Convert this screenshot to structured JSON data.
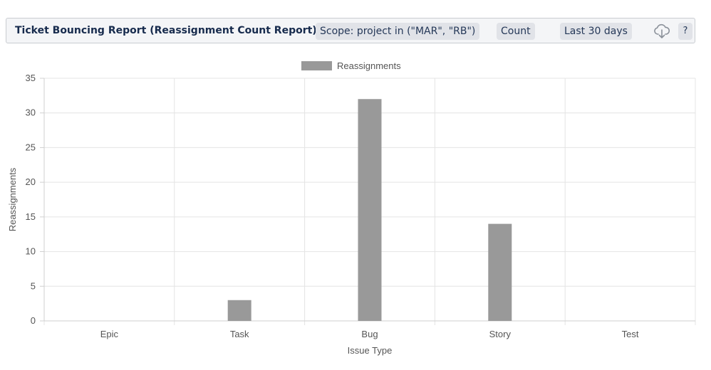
{
  "toolbar": {
    "title": "Ticket Bouncing Report (Reassignment Count Report)",
    "scope": "Scope: project in (\"MAR\", \"RB\")",
    "metric": "Count",
    "range": "Last 30 days",
    "help": "?",
    "download_icon": "cloud-download-icon"
  },
  "chart_data": {
    "type": "bar",
    "title": "",
    "xlabel": "Issue Type",
    "ylabel": "Reassignments",
    "categories": [
      "Epic",
      "Task",
      "Bug",
      "Story",
      "Test"
    ],
    "series": [
      {
        "name": "Reassignments",
        "values": [
          0,
          3,
          32,
          14,
          0
        ],
        "color": "#999999"
      }
    ],
    "ylim": [
      0,
      35
    ],
    "yticks": [
      0,
      5,
      10,
      15,
      20,
      25,
      30,
      35
    ],
    "legend": "top-center",
    "grid": true
  }
}
